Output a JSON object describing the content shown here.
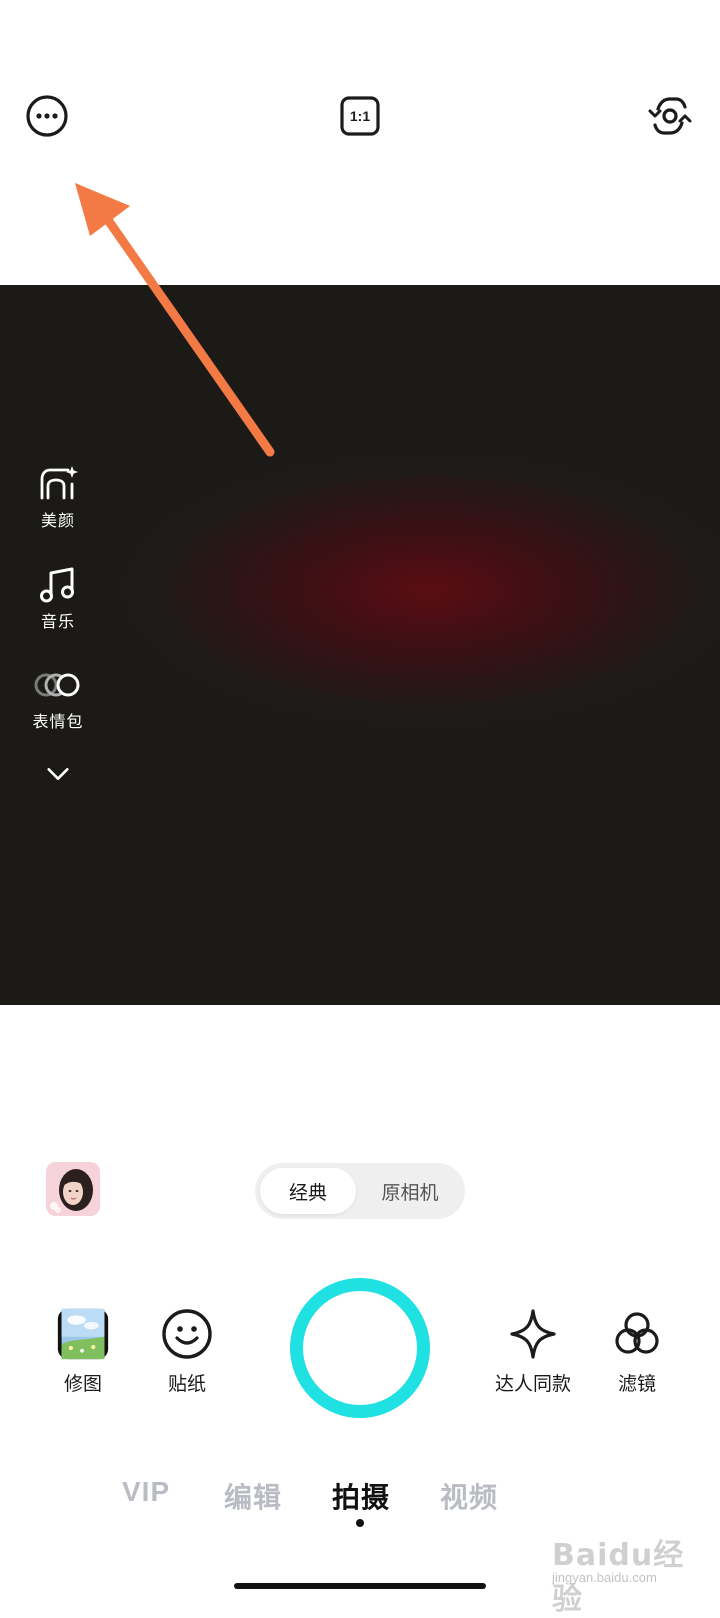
{
  "top_bar": {
    "more_icon": "more-horizontal-icon",
    "ratio_label": "1:1",
    "flip_icon": "camera-flip-icon"
  },
  "annotation": {
    "arrow_color": "#f37a45",
    "arrow_icon": "pointer-arrow"
  },
  "side_tools": [
    {
      "label": "美颜",
      "icon": "beauty-face-icon"
    },
    {
      "label": "音乐",
      "icon": "music-note-icon"
    },
    {
      "label": "表情包",
      "icon": "sticker-circles-icon"
    },
    {
      "label": "",
      "icon": "chevron-down-icon"
    }
  ],
  "mode_switch": {
    "active": "经典",
    "inactive": "原相机"
  },
  "tools": {
    "edit_photo": "修图",
    "stickers": "贴纸",
    "same_style": "达人同款",
    "filters": "滤镜"
  },
  "shutter": {
    "color": "#1fe1e2"
  },
  "tabs": [
    {
      "label": "VIP",
      "active": false
    },
    {
      "label": "编辑",
      "active": false
    },
    {
      "label": "拍摄",
      "active": true
    },
    {
      "label": "视频",
      "active": false
    }
  ],
  "watermark": {
    "main": "Baidu经验",
    "sub": "jingyan.baidu.com"
  }
}
